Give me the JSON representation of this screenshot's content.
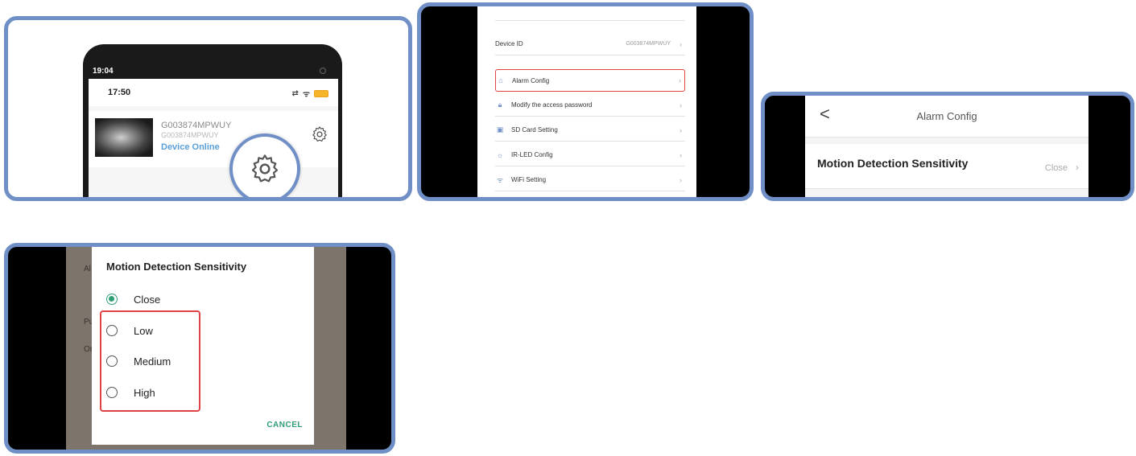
{
  "panel1": {
    "outer_time": "19:04",
    "status_time": "17:50",
    "device": {
      "name": "G003874MPWUY",
      "sub_id": "G003874MPWUY",
      "status": "Device Online"
    },
    "settings_icon": "gear-icon"
  },
  "panel2": {
    "rows": [
      {
        "label": "Device ID",
        "value": "G003874MPWUY",
        "icon": ""
      },
      {
        "label": "Alarm Config",
        "icon": "alarm-icon",
        "highlighted": true
      },
      {
        "label": "Modify the access password",
        "icon": "lock-icon"
      },
      {
        "label": "SD Card Setting",
        "icon": "sd-card-icon"
      },
      {
        "label": "IR-LED Config",
        "icon": "bulb-icon"
      },
      {
        "label": "WiFi Setting",
        "icon": "wifi-icon"
      }
    ]
  },
  "panel3": {
    "back": "<",
    "title": "Alarm Config",
    "row_label": "Motion Detection Sensitivity",
    "row_value": "Close"
  },
  "panel4": {
    "title": "Motion Detection Sensitivity",
    "options": [
      {
        "label": "Close",
        "selected": true
      },
      {
        "label": "Low",
        "selected": false
      },
      {
        "label": "Medium",
        "selected": false
      },
      {
        "label": "High",
        "selected": false
      }
    ],
    "cancel": "CANCEL",
    "bg_fragments": [
      "Al",
      "Pu",
      "On"
    ]
  },
  "colors": {
    "frame": "#6f8fc6",
    "highlight": "#e04343",
    "accent_green": "#2f9e72",
    "online_blue": "#5a9fd8"
  }
}
